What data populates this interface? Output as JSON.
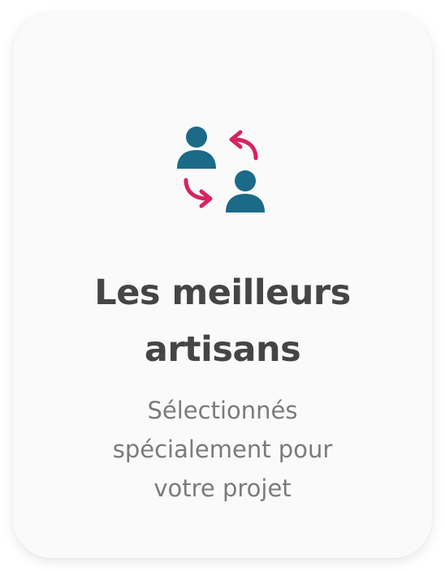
{
  "card": {
    "icon": "swap-users-icon",
    "title_lines": [
      "Les meilleurs",
      "artisans"
    ],
    "subtitle_lines": [
      "Sélectionnés",
      "spécialement pour",
      "votre projet"
    ]
  },
  "colors": {
    "person": "#1b6a87",
    "arrows": "#d6245e",
    "title": "#454545",
    "subtitle": "#7b7b7b",
    "card_bg": "#fafafa"
  }
}
